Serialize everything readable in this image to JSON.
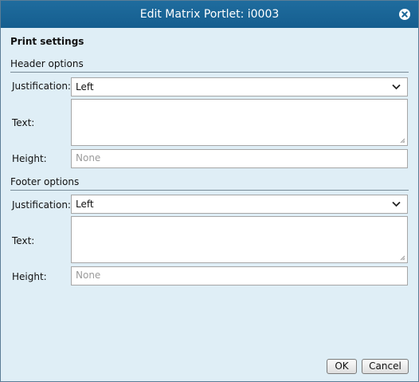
{
  "dialog": {
    "title": "Edit Matrix Portlet: i0003",
    "close_icon": "close-circle-icon"
  },
  "print_settings": {
    "title": "Print settings",
    "header": {
      "heading": "Header options",
      "justification_label": "Justification:",
      "justification_value": "Left",
      "text_label": "Text:",
      "text_value": "",
      "height_label": "Height:",
      "height_value": "",
      "height_placeholder": "None"
    },
    "footer": {
      "heading": "Footer options",
      "justification_label": "Justification:",
      "justification_value": "Left",
      "text_label": "Text:",
      "text_value": "",
      "height_label": "Height:",
      "height_value": "",
      "height_placeholder": "None"
    }
  },
  "buttons": {
    "ok": "OK",
    "cancel": "Cancel"
  },
  "colors": {
    "titlebar": "#1a6596",
    "body_background": "#dfeef6",
    "border": "#5b7d96"
  }
}
